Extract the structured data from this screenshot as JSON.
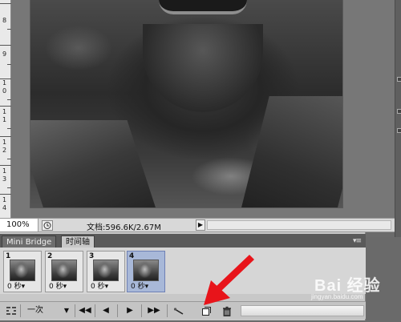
{
  "ruler": {
    "labels": [
      "8",
      "9",
      "1",
      "0",
      "1",
      "1",
      "1",
      "2",
      "1",
      "3",
      "1",
      "4"
    ]
  },
  "status_bar": {
    "zoom": "100%",
    "doc_info": "文档:596.6K/2.67M",
    "arrow": "▶"
  },
  "panel": {
    "tabs": [
      "Mini Bridge",
      "时间轴"
    ],
    "menu_icon": "▾≡",
    "frames": [
      {
        "number": "1",
        "delay": "0 秒▾",
        "selected": false
      },
      {
        "number": "2",
        "delay": "0 秒▾",
        "selected": false
      },
      {
        "number": "3",
        "delay": "0 秒▾",
        "selected": false
      },
      {
        "number": "4",
        "delay": "0 秒▾",
        "selected": true
      }
    ],
    "toolbar": {
      "convert_icon": "convert-to-video-timeline-icon",
      "loop_option": "一次",
      "loop_dropdown": "▼",
      "first_frame": "◀◀",
      "prev_frame": "◀",
      "play": "▶",
      "next_frame": "▶▶",
      "tween_icon": "tween-icon",
      "duplicate_frame_icon": "duplicate-frame-icon",
      "delete_frame_icon": "trash-icon"
    }
  },
  "annotation": {
    "color": "#e8141a"
  },
  "watermark": {
    "brand": "Bai 经验",
    "url": "jingyan.baidu.com"
  }
}
